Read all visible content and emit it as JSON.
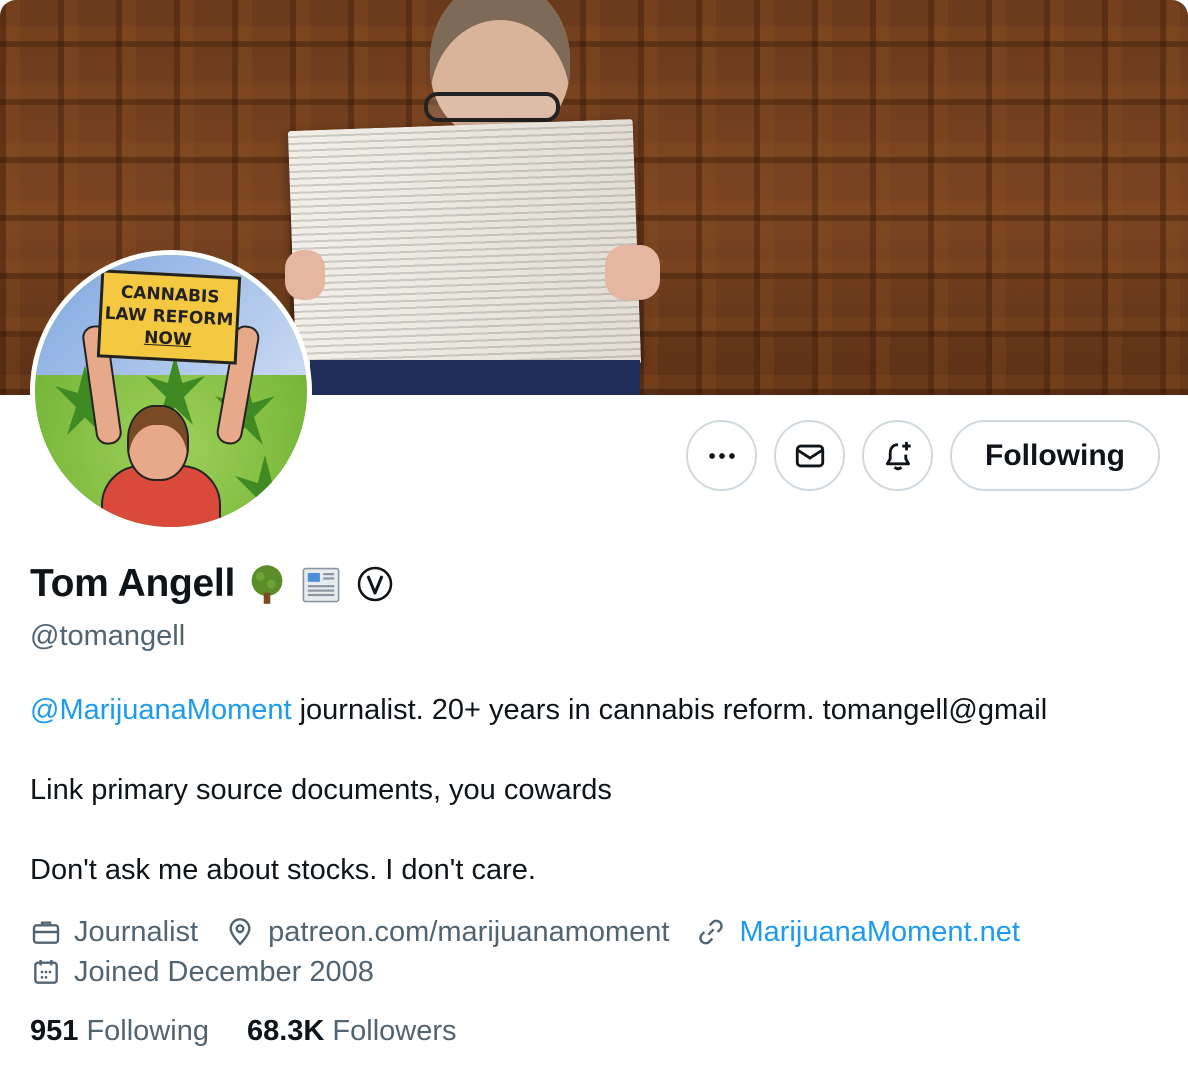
{
  "profile": {
    "name": "Tom Angell",
    "handle": "@tomangell",
    "name_emojis": [
      "tree-emoji",
      "newspaper-emoji",
      "v-circled-badge"
    ],
    "accent_color": "#1d9bf0"
  },
  "actions": {
    "more_icon": "ellipsis-icon",
    "message_icon": "envelope-icon",
    "notify_icon": "bell-plus-icon",
    "following_label": "Following"
  },
  "bio": {
    "mention": "@MarijuanaMoment",
    "line1_rest": " journalist. 20+ years in cannabis reform. tomangell@gmail",
    "line2": "Link primary source documents, you cowards",
    "line3": "Don't ask me about stocks. I don't care."
  },
  "meta": {
    "profession": "Journalist",
    "location": "patreon.com/marijuanamoment",
    "website": "MarijuanaMoment.net",
    "joined": "Joined December 2008"
  },
  "stats": {
    "following_count": "951",
    "following_label": "Following",
    "followers_count": "68.3K",
    "followers_label": "Followers"
  },
  "avatar_sign": {
    "line1": "CANNABIS",
    "line2": "LAW REFORM",
    "line3": "NOW"
  }
}
